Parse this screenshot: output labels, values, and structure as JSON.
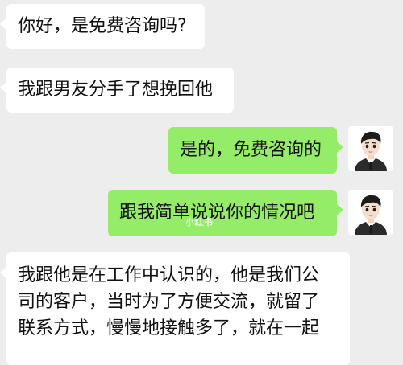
{
  "messages": [
    {
      "side": "in",
      "text": "你好，是免费咨询吗?"
    },
    {
      "side": "in",
      "text": "我跟男友分手了想挽回他"
    },
    {
      "side": "out",
      "text": "是的，免费咨询的"
    },
    {
      "side": "out",
      "text": "跟我简单说说你的情况吧"
    },
    {
      "side": "in",
      "lines": [
        "我跟他是在工作中认识的，他是我们公",
        "司的客户，当时为了方便交流，就留了",
        "联系方式，慢慢地接触多了，就在一起"
      ]
    }
  ],
  "watermark": "小红书",
  "colors": {
    "background": "#ededed",
    "incoming_bubble": "#ffffff",
    "outgoing_bubble": "#95ec69",
    "suit": "#2b2b2b",
    "hair": "#1c1c1c",
    "skin": "#f6dccb"
  },
  "icons": {
    "avatar": "cartoon-man-in-suit-avatar"
  }
}
